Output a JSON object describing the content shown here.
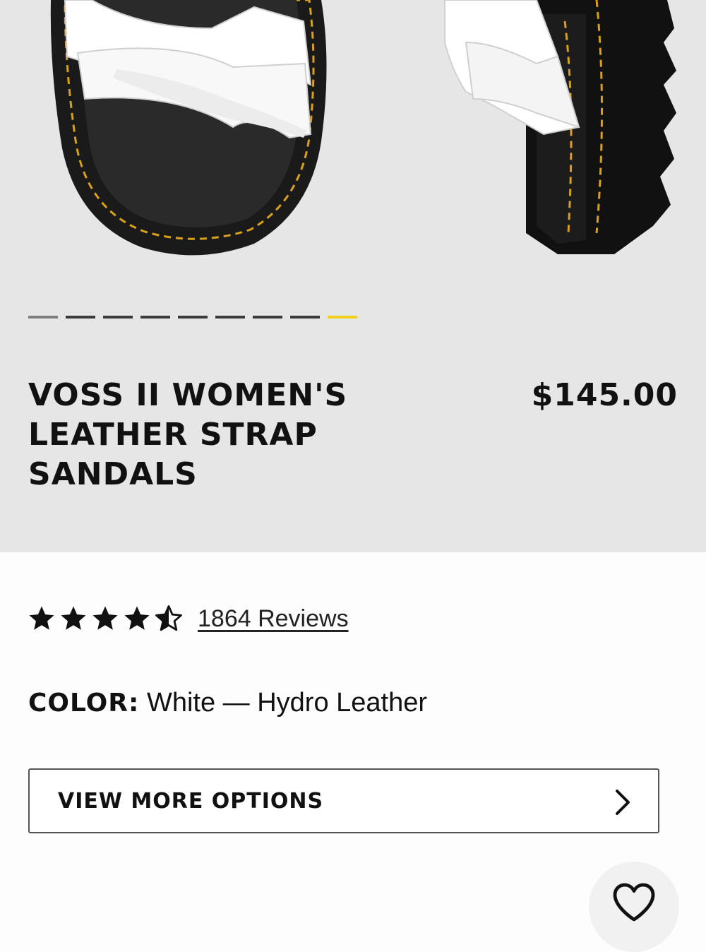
{
  "product": {
    "title": "VOSS II WOMEN'S LEATHER STRAP SANDALS",
    "price": "$145.00"
  },
  "carousel": {
    "total_slides": 9,
    "active_slide": 9,
    "accent_color": "#f2d21c"
  },
  "rating": {
    "stars": 4.5,
    "max_stars": 5,
    "reviews_label": "1864 Reviews"
  },
  "color": {
    "label": "COLOR:",
    "value": "White — Hydro Leather"
  },
  "options_button": {
    "label": "VIEW MORE OPTIONS",
    "icon": "chevron-right-icon"
  },
  "wishlist": {
    "icon": "heart-icon"
  }
}
